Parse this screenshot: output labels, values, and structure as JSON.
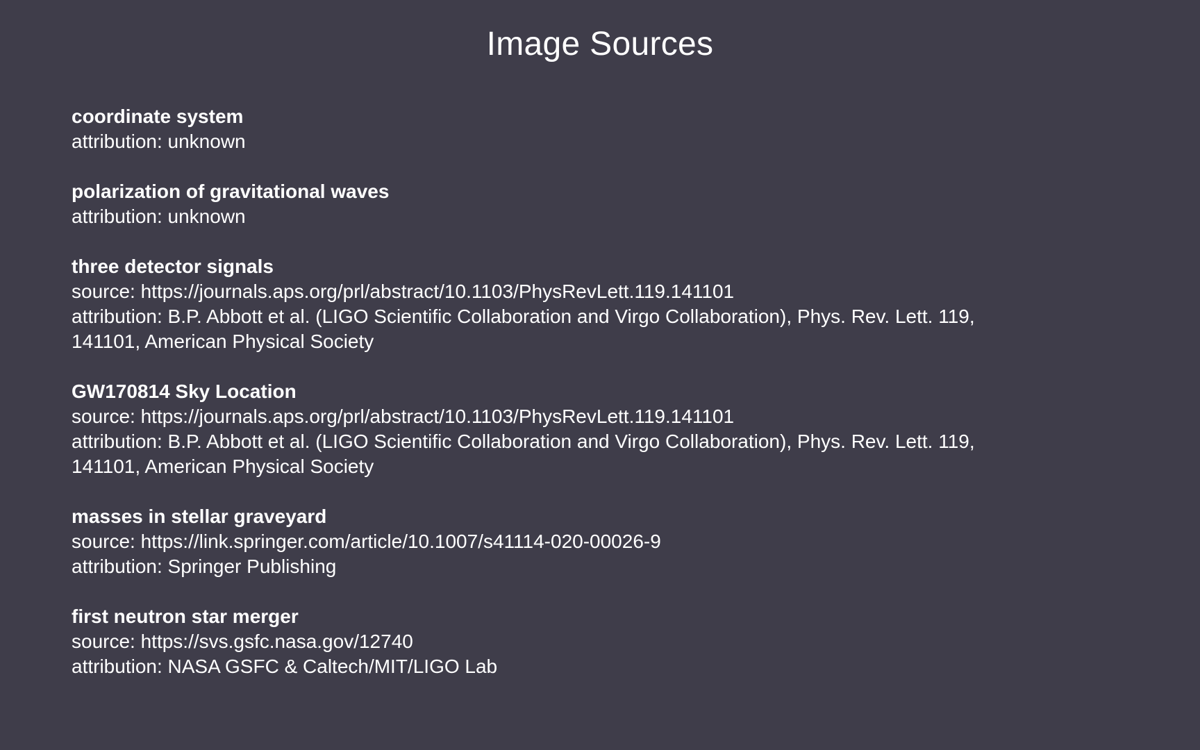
{
  "slide": {
    "title": "Image Sources",
    "entries": [
      {
        "title": "coordinate system",
        "lines": [
          "attribution: unknown"
        ]
      },
      {
        "title": "polarization of gravitational waves",
        "lines": [
          "attribution: unknown"
        ]
      },
      {
        "title": "three detector signals",
        "lines": [
          "source: https://journals.aps.org/prl/abstract/10.1103/PhysRevLett.119.141101",
          "attribution: B.P. Abbott et al. (LIGO Scientific Collaboration and Virgo Collaboration), Phys. Rev. Lett. 119,",
          "141101, American Physical Society"
        ]
      },
      {
        "title": "GW170814 Sky Location",
        "lines": [
          "source: https://journals.aps.org/prl/abstract/10.1103/PhysRevLett.119.141101",
          "attribution: B.P. Abbott et al. (LIGO Scientific Collaboration and Virgo Collaboration), Phys. Rev. Lett. 119,",
          "141101, American Physical Society"
        ]
      },
      {
        "title": "masses in stellar graveyard",
        "lines": [
          "source: https://link.springer.com/article/10.1007/s41114-020-00026-9",
          "attribution: Springer Publishing"
        ]
      },
      {
        "title": "first neutron star merger",
        "lines": [
          "source: https://svs.gsfc.nasa.gov/12740",
          "attribution: NASA GSFC & Caltech/MIT/LIGO Lab"
        ]
      }
    ]
  }
}
